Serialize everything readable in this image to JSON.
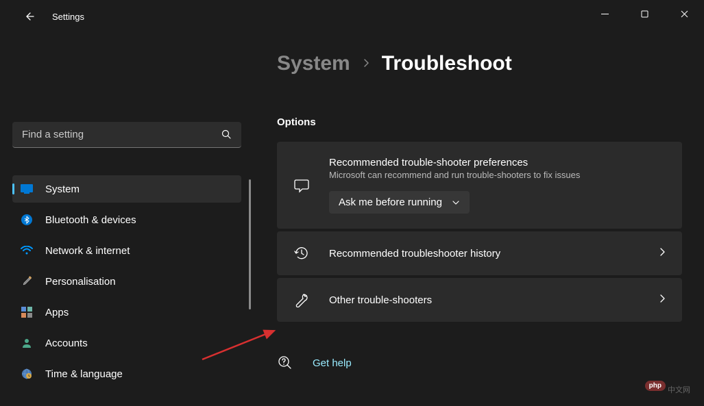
{
  "window": {
    "app_title": "Settings"
  },
  "search": {
    "placeholder": "Find a setting"
  },
  "sidebar": {
    "items": [
      {
        "label": "System"
      },
      {
        "label": "Bluetooth & devices"
      },
      {
        "label": "Network & internet"
      },
      {
        "label": "Personalisation"
      },
      {
        "label": "Apps"
      },
      {
        "label": "Accounts"
      },
      {
        "label": "Time & language"
      }
    ]
  },
  "breadcrumb": {
    "parent": "System",
    "current": "Troubleshoot"
  },
  "main": {
    "section_title": "Options",
    "cards": [
      {
        "title": "Recommended trouble-shooter preferences",
        "subtitle": "Microsoft can recommend and run trouble-shooters to fix issues",
        "dropdown": "Ask me before running"
      },
      {
        "title": "Recommended troubleshooter history"
      },
      {
        "title": "Other trouble-shooters"
      }
    ],
    "help": "Get help"
  },
  "watermark": {
    "badge": "php",
    "text": "中文网"
  }
}
